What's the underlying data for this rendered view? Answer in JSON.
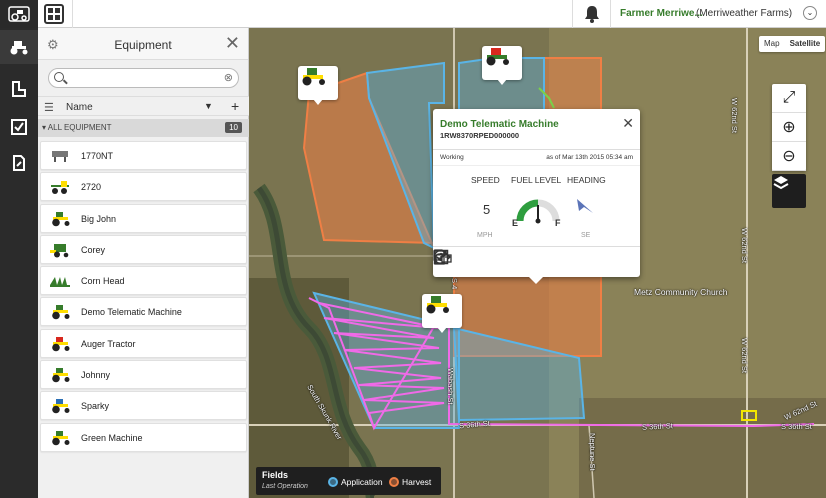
{
  "topbar": {
    "user_name": "Farmer Merriwe...",
    "org_name": "(Merriweather Farms)"
  },
  "panel": {
    "title": "Equipment",
    "search_placeholder": "",
    "column_name": "Name",
    "group_label": "ALL EQUIPMENT",
    "group_count": "10",
    "items": [
      {
        "name": "1770NT",
        "icon": "planter-icon"
      },
      {
        "name": "2720",
        "icon": "sprayer-icon"
      },
      {
        "name": "Big John",
        "icon": "tractor-icon"
      },
      {
        "name": "Corey",
        "icon": "combine-icon"
      },
      {
        "name": "Corn Head",
        "icon": "header-icon"
      },
      {
        "name": "Demo Telematic Machine",
        "icon": "tractor-icon"
      },
      {
        "name": "Auger Tractor",
        "icon": "tractor-icon"
      },
      {
        "name": "Johnny",
        "icon": "tractor-icon"
      },
      {
        "name": "Sparky",
        "icon": "tractor-icon"
      },
      {
        "name": "Green Machine",
        "icon": "tractor-icon"
      }
    ]
  },
  "map": {
    "toggle_map": "Map",
    "toggle_satellite": "Satellite",
    "streets": {
      "w62nd_a": "W 62nd St",
      "w62nd_b": "W 62nd St",
      "w62nd_c": "W 62nd St",
      "s36th_a": "S 36th St",
      "s36th_b": "S 36th St",
      "s36th_c": "S 36th St",
      "neptune": "Neptune St",
      "river": "South Skunk River",
      "wabash": "Wabash St",
      "s4": "S 4"
    },
    "poi": "Metz Community Church",
    "colors": {
      "application": "#5ab4e6",
      "harvest": "#ef7f45",
      "path": "#f06ae8",
      "brand": "#367c2b"
    }
  },
  "popup": {
    "title": "Demo Telematic Machine",
    "serial": "1RW8370RPED000000",
    "status": "Working",
    "timestamp": "as of Mar 13th 2015 05:34 am",
    "speed_label": "SPEED",
    "speed_value": "5",
    "speed_unit": "MPH",
    "fuel_label": "FUEL LEVEL",
    "fuel_empty": "E",
    "fuel_full": "F",
    "fuel_level": 0.5,
    "heading_label": "HEADING",
    "heading_value": "SE"
  },
  "legend": {
    "title": "Fields",
    "subtitle": "Last Operation",
    "application": "Application",
    "harvest": "Harvest"
  }
}
